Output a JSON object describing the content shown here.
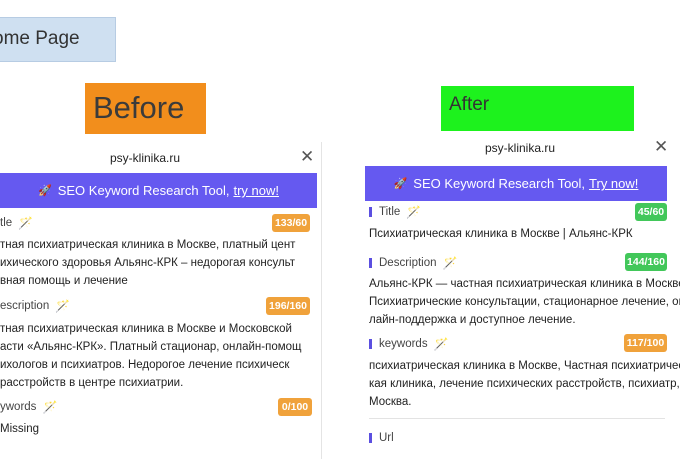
{
  "home_label": "ome Page",
  "before_label": "Before",
  "after_label": "After",
  "left": {
    "site": "psy-klinika.ru",
    "banner": {
      "text": "SEO Keyword Research Tool,",
      "link": "try now!"
    },
    "title": {
      "label": "tle",
      "count": "133/60",
      "lines": [
        "тная психиатрическая клиника в Москве, платный цент",
        "ихического здоровья Альянс-КРК – недорогая консульт",
        "вная помощь и лечение"
      ]
    },
    "description": {
      "label": "escription",
      "count": "196/160",
      "lines": [
        "тная психиатрическая клиника в Москве и Московской",
        "асти «Альянс-КРК». Платный стационар, онлайн-помощ",
        "ихологов и психиатров. Недорогое лечение психическ",
        "расстройств в центре психиатрии."
      ]
    },
    "keywords": {
      "label": "ywords",
      "count": "0/100",
      "value": "Missing"
    }
  },
  "right": {
    "site": "psy-klinika.ru",
    "banner": {
      "text": "SEO Keyword Research Tool,",
      "link": "Try now!"
    },
    "title": {
      "label": "Title",
      "count": "45/60",
      "lines": [
        "Психиатрическая клиника в Москве | Альянс-КРК"
      ]
    },
    "description": {
      "label": "Description",
      "count": "144/160",
      "lines": [
        "Альянс-КРК — частная психиатрическая клиника в Москве.",
        "Психиатрические консультации, стационарное лечение, он",
        "лайн-поддержка и доступное лечение."
      ]
    },
    "keywords": {
      "label": "keywords",
      "count": "117/100",
      "lines": [
        "психиатрическая клиника в Москве, Частная психиатричес",
        "кая клиника, лечение психических расстройств, психиатр,",
        "Москва."
      ]
    },
    "url": {
      "label": "Url"
    }
  },
  "colors": {
    "banner": "#6559f0",
    "badge_over": "#f0a23b",
    "badge_ok": "#42c75a",
    "before_tag": "#f28e1c",
    "after_tag": "#1df21d",
    "home_tag": "#cfe0f1"
  }
}
